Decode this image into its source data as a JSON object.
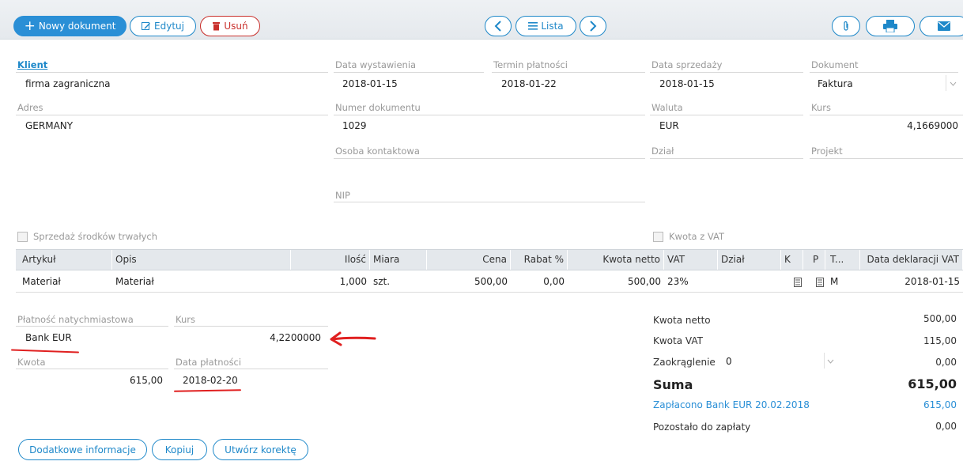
{
  "toolbar": {
    "new_doc": "Nowy dokument",
    "edit": "Edytuj",
    "delete": "Usuń",
    "list": "Lista"
  },
  "client": {
    "label": "Klient",
    "value": "firma zagraniczna",
    "address_label": "Adres",
    "address_value": "GERMANY"
  },
  "dates": {
    "issue_label": "Data wystawienia",
    "issue_value": "2018-01-15",
    "due_label": "Termin płatności",
    "due_value": "2018-01-22",
    "sale_label": "Data sprzedaży",
    "sale_value": "2018-01-15"
  },
  "document": {
    "type_label": "Dokument",
    "type_value": "Faktura",
    "number_label": "Numer dokumentu",
    "number_value": "1029",
    "currency_label": "Waluta",
    "currency_value": "EUR",
    "rate_label": "Kurs",
    "rate_value": "4,1669000",
    "contact_label": "Osoba kontaktowa",
    "department_label": "Dział",
    "project_label": "Projekt",
    "nip_label": "NIP"
  },
  "checkboxes": {
    "fixed_assets": "Sprzedaż środków trwałych",
    "amount_with_vat": "Kwota z VAT"
  },
  "table": {
    "headers": [
      "Artykuł",
      "Opis",
      "Ilość",
      "Miara",
      "Cena",
      "Rabat %",
      "Kwota netto",
      "VAT",
      "Dział",
      "K",
      "P",
      "T...",
      "Data deklaracji VAT"
    ],
    "rows": [
      [
        "Materiał",
        "Materiał",
        "1,000",
        "szt.",
        "500,00",
        "0,00",
        "500,00",
        "23%",
        "",
        "",
        "",
        "M",
        "2018-01-15"
      ]
    ]
  },
  "payment": {
    "method_label": "Płatność natychmiastowa",
    "method_value": "Bank EUR",
    "rate_label": "Kurs",
    "rate_value": "4,2200000",
    "amount_label": "Kwota",
    "amount_value": "615,00",
    "date_label": "Data płatności",
    "date_value": "2018-02-20"
  },
  "summary": {
    "net_label": "Kwota netto",
    "net_value": "500,00",
    "vat_label": "Kwota VAT",
    "vat_value": "115,00",
    "rounding_label": "Zaokrąglenie",
    "rounding_select": "0",
    "rounding_value": "0,00",
    "total_label": "Suma",
    "total_value": "615,00",
    "paid_label": "Zapłacono Bank EUR 20.02.2018",
    "paid_value": "615,00",
    "remaining_label": "Pozostało do zapłaty",
    "remaining_value": "0,00"
  },
  "bottom": {
    "additional": "Dodatkowe informacje",
    "copy": "Kopiuj",
    "correction": "Utwórz korektę"
  },
  "colors": {
    "accent": "#1e88c9",
    "danger": "#c9302c",
    "annotation": "#e02020"
  }
}
